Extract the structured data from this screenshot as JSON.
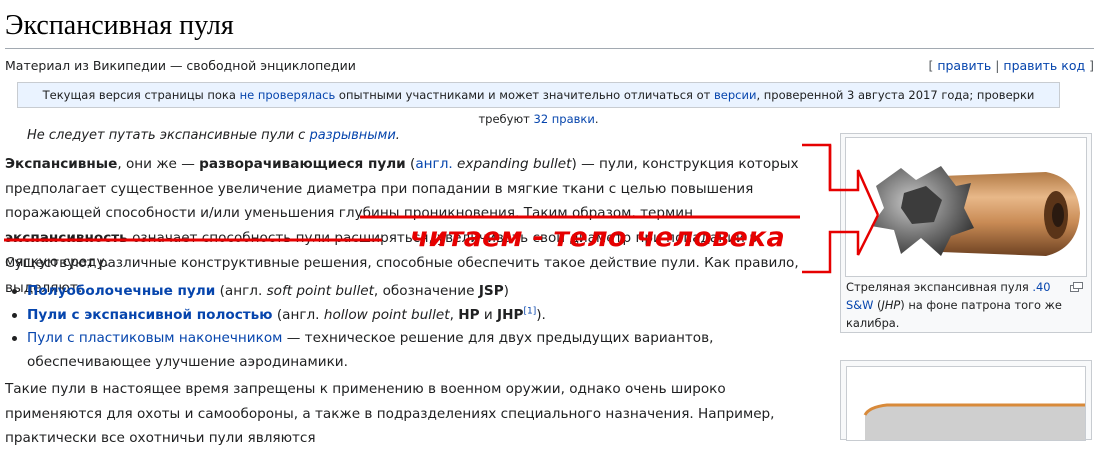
{
  "article": {
    "title": "Экспансивная пуля",
    "site_sub": "Материал из Википедии — свободной энциклопедии",
    "edit": {
      "open": "[",
      "edit": "править",
      "sep": " | ",
      "edit_code": "править код",
      "close": "]"
    }
  },
  "notice": {
    "t1": "Текущая версия страницы пока ",
    "l1": "не проверялась",
    "t2": " опытными участниками и может значительно отличаться от ",
    "l2": "версии",
    "t3": ", проверенной 3 августа 2017 года; проверки требуют ",
    "l3": "32 правки",
    "t4": "."
  },
  "hatnote": {
    "text": "Не следует путать экспансивные пули с ",
    "link": "разрывными",
    "end": "."
  },
  "intro": {
    "b1": "Экспансивные",
    "t1": ", они же — ",
    "b2": "разворачивающиеся пули",
    "t2": " (",
    "l1": "англ.",
    "t3": " ",
    "i1": "expanding bullet",
    "t4": ") — пули, конструкция которых предполагает существенное увеличение диаметра при попадании в мягкие ткани с целью повышения поражающей способности и/или уменьшения глубины проникновения. Таким образом, термин ",
    "b3": "экспансивность",
    "t5": " означает способность пули расширяться, увеличивать свой диаметр при попадании в мягкую среду."
  },
  "para2": "Существуют различные конструктивные решения, способные обеспечить такое действие пули. Как правило, выделяют:",
  "bullets": [
    {
      "link": "Полуоболочечные пули",
      "t1": " (англ. ",
      "i": "soft point bullet",
      "t2": ", обозначение ",
      "b": "JSP",
      "t3": ")"
    },
    {
      "link": "Пули с экспансивной полостью",
      "t1": " (англ. ",
      "i": "hollow point bullet",
      "t2": ", ",
      "b": "HP",
      "t3": " и ",
      "b2": "JHP",
      "sup": "[1]",
      "t4": ")."
    },
    {
      "link": "Пули с пластиковым наконечником",
      "t1": " — техническое решение для двух предыдущих вариантов, обеспечивающее улучшение аэродинамики."
    }
  ],
  "para3": "Такие пули в настоящее время запрещены к применению в военном оружии, однако очень широко применяются для охоты и самообороны, а также в подразделениях специального назначения. Например, практически все охотничьи пули являются",
  "thumb": {
    "cap1": "Стреляная экспансивная пуля ",
    "cap_link": ".40 S&W",
    "cap2": " (",
    "cap_i": "JHP",
    "cap3": ") на фоне патрона того же калибра."
  },
  "annotation": "читаем - тело человека",
  "colors": {
    "link": "#0645ad",
    "annotation": "#e60000",
    "notice_bg": "#eaf3ff"
  }
}
